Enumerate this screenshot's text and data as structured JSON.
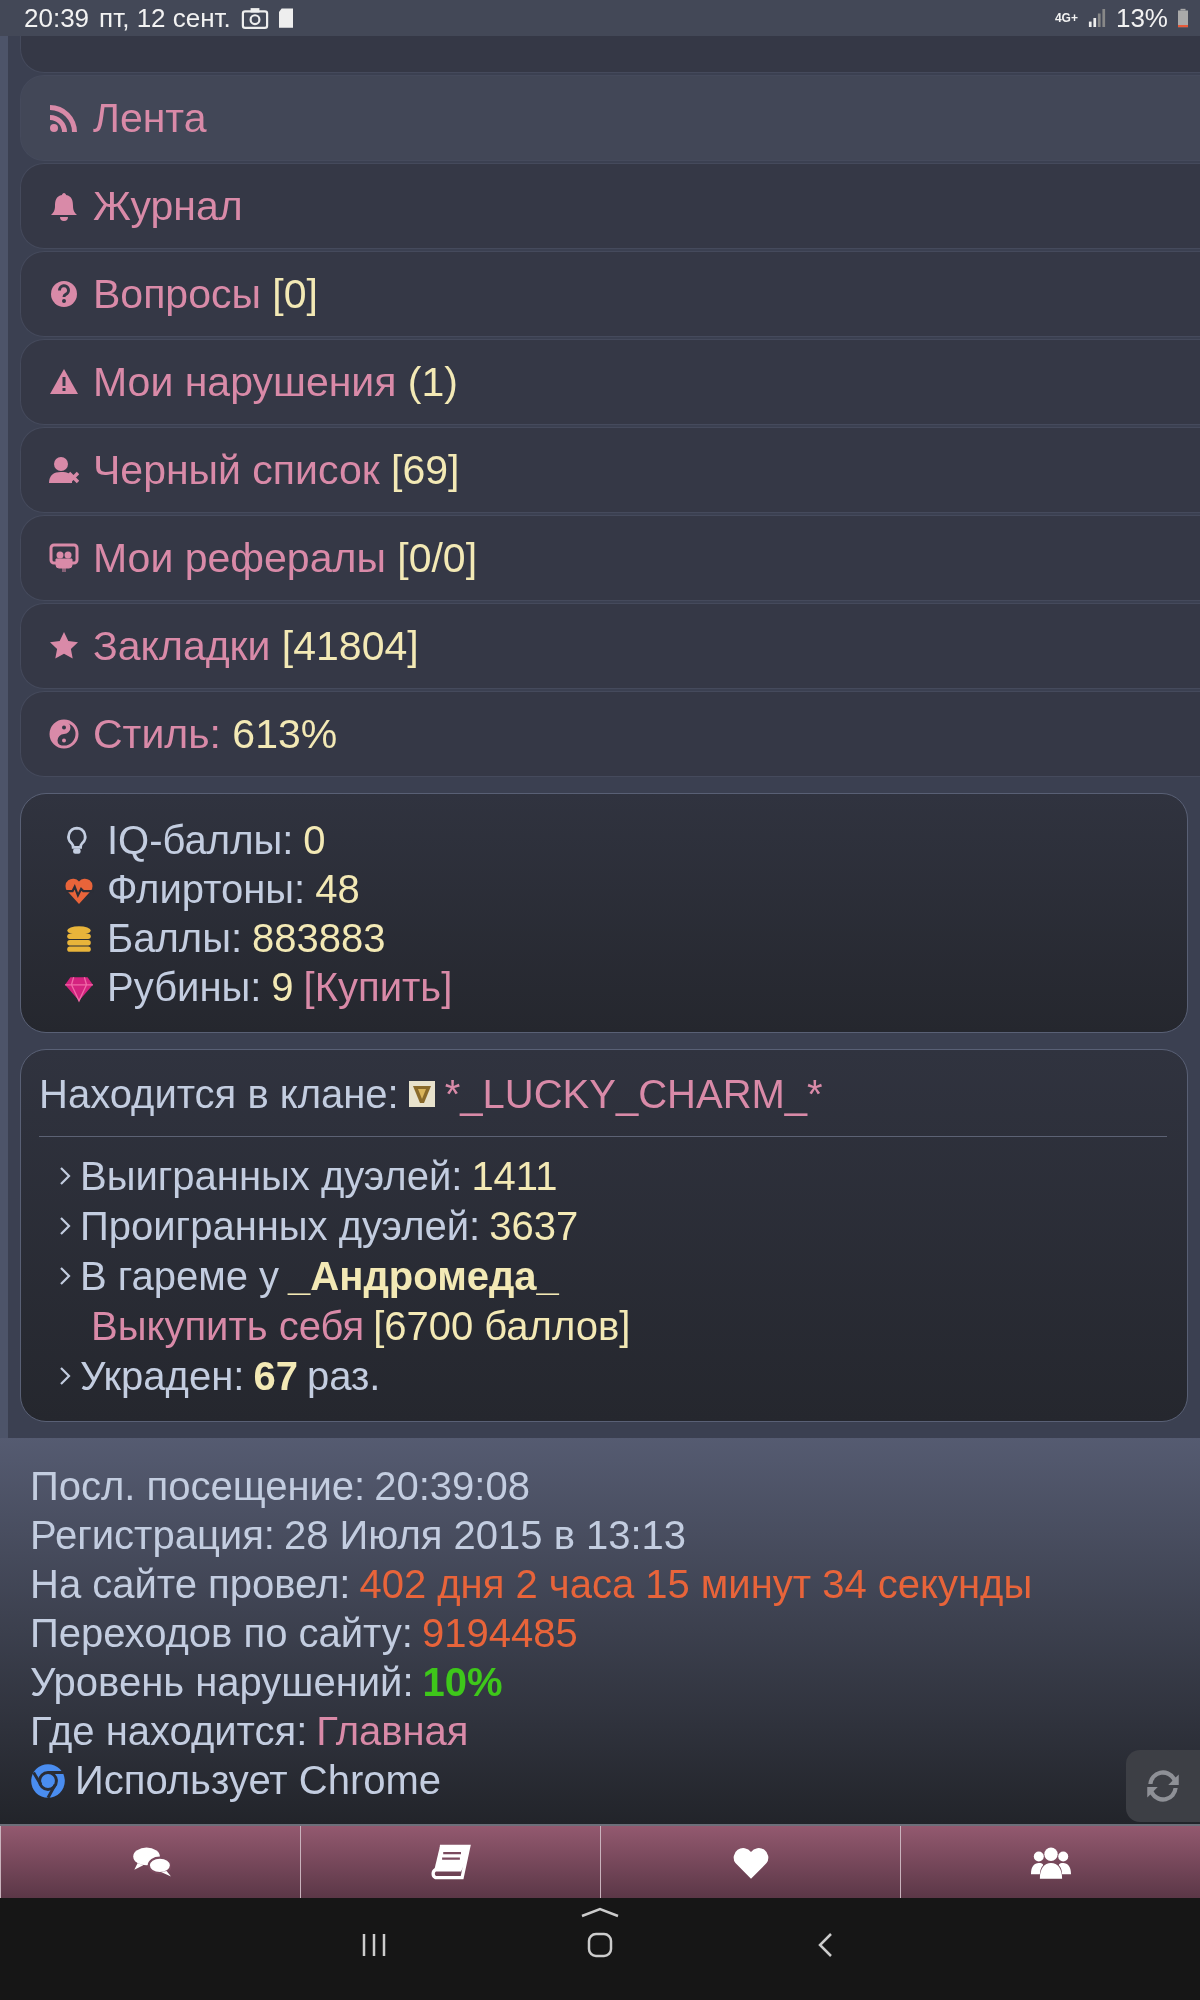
{
  "status_bar": {
    "time": "20:39",
    "date": "пт, 12 сент.",
    "network": "4G+",
    "battery": "13%"
  },
  "menu": [
    {
      "label": "Лента",
      "selected": true
    },
    {
      "label": "Журнал",
      "selected": false
    },
    {
      "label": "Вопросы",
      "count": "[0]",
      "selected": false
    },
    {
      "label": "Мои нарушения",
      "count": "(1)",
      "selected": false
    },
    {
      "label": "Черный список",
      "count": "[69]",
      "selected": false
    },
    {
      "label": "Мои рефералы",
      "count": "[0/0]",
      "selected": false
    },
    {
      "label": "Закладки",
      "count": "[41804]",
      "selected": false
    },
    {
      "label": "Стиль:",
      "count": "613%",
      "selected": false
    }
  ],
  "currency": [
    {
      "label": "IQ-баллы:",
      "value": "0"
    },
    {
      "label": "Флиртоны:",
      "value": "48"
    },
    {
      "label": "Баллы:",
      "value": "883883"
    },
    {
      "label": "Рубины:",
      "value": "9",
      "link": "[Купить]"
    }
  ],
  "clan": {
    "label": "Находится в клане:",
    "name": "*_LUCKY_CHARM_*"
  },
  "clan_stats": [
    {
      "kind": "stat",
      "label": "Выигранных дуэлей:",
      "value": "1411"
    },
    {
      "kind": "stat",
      "label": "Проигранных дуэлей:",
      "value": "3637"
    },
    {
      "kind": "harem",
      "label": "В гареме у",
      "owner": "_Андромеда_",
      "action": "Выкупить себя",
      "price": "[6700 баллов]"
    },
    {
      "kind": "stolen",
      "label": "Украден:",
      "count": "67",
      "suffix": "раз."
    }
  ],
  "info": [
    {
      "label": "Посл. посещение:",
      "value": "20:39:08",
      "kind": "plain"
    },
    {
      "label": "Регистрация:",
      "value": "28 Июля 2015 в 13:13",
      "kind": "plain"
    },
    {
      "label": "На сайте провел:",
      "value": "402 дня 2 часа 15 минут 34 секунды",
      "kind": "duration"
    },
    {
      "label": "Переходов по сайту:",
      "value": "9194485",
      "kind": "duration"
    },
    {
      "label": "Уровень нарушений:",
      "value": "10%",
      "kind": "level"
    },
    {
      "label": "Где находится:",
      "value": "Главная",
      "kind": "location"
    }
  ],
  "browser": {
    "label": "Использует Chrome"
  }
}
